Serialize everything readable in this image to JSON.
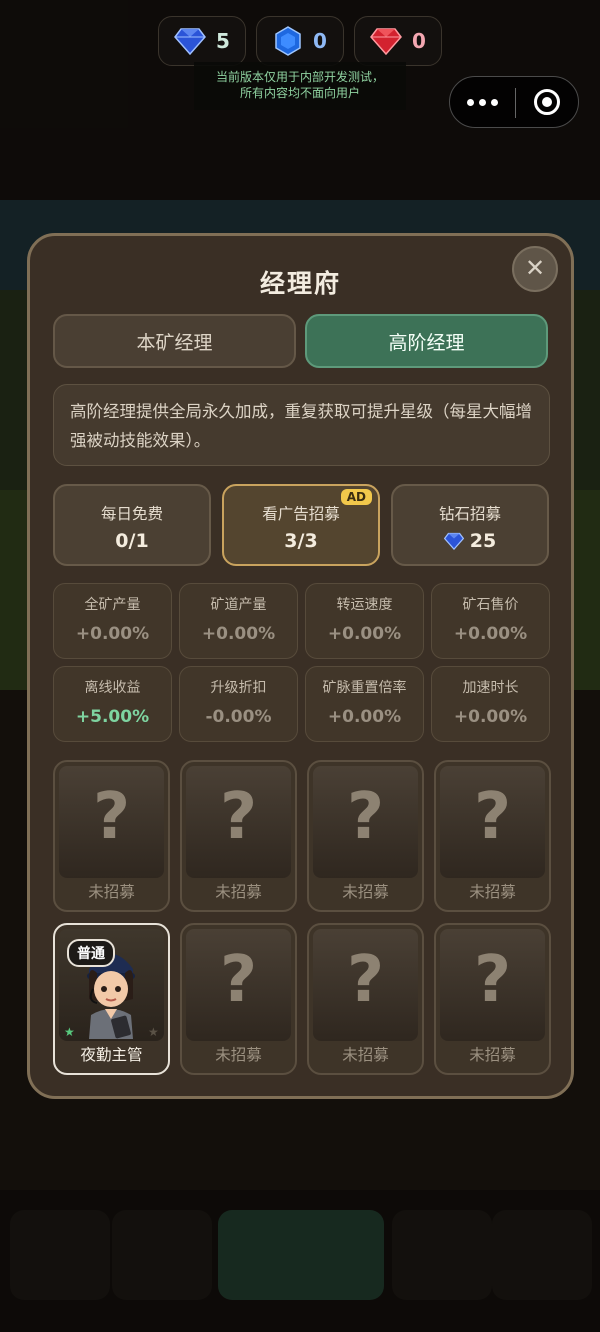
{
  "currencies": [
    {
      "icon": "blue-diamond-icon",
      "value": "5",
      "color": "#cfe9dc"
    },
    {
      "icon": "blue-sapphire-icon",
      "value": "0",
      "color": "#8fb9f5"
    },
    {
      "icon": "red-ruby-icon",
      "value": "0",
      "color": "#f4a7b1"
    }
  ],
  "notice": {
    "line1": "当前版本仅用于内部开发测试，",
    "line2": "所有内容均不面向用户"
  },
  "panel": {
    "title": "经理府",
    "tabs": [
      "本矿经理",
      "高阶经理"
    ],
    "active_tab": 1,
    "description": "高阶经理提供全局永久加成，重复获取可提升星级（每星大幅增强被动技能效果）。",
    "recruit": [
      {
        "label": "每日免费",
        "value": "0/1"
      },
      {
        "label": "看广告招募",
        "value": "3/3",
        "badge": "AD"
      },
      {
        "label": "钻石招募",
        "value": "25",
        "icon": "blue-diamond-icon"
      }
    ],
    "stats": [
      {
        "label": "全矿产量",
        "value": "+0.00%"
      },
      {
        "label": "矿道产量",
        "value": "+0.00%"
      },
      {
        "label": "转运速度",
        "value": "+0.00%"
      },
      {
        "label": "矿石售价",
        "value": "+0.00%"
      },
      {
        "label": "离线收益",
        "value": "+5.00%",
        "positive": true
      },
      {
        "label": "升级折扣",
        "value": "-0.00%"
      },
      {
        "label": "矿脉重置倍率",
        "value": "+0.00%"
      },
      {
        "label": "加速时长",
        "value": "+0.00%"
      }
    ],
    "managers": [
      {
        "name": "未招募"
      },
      {
        "name": "未招募"
      },
      {
        "name": "未招募"
      },
      {
        "name": "未招募"
      },
      {
        "name": "夜勤主管",
        "rarity": "普通",
        "recruited": true
      },
      {
        "name": "未招募"
      },
      {
        "name": "未招募"
      },
      {
        "name": "未招募"
      }
    ],
    "unknown_mark": "?"
  },
  "colors": {
    "accent_green": "#3d7257",
    "ad_badge": "#f2c84b",
    "positive": "#7ed4a0"
  }
}
